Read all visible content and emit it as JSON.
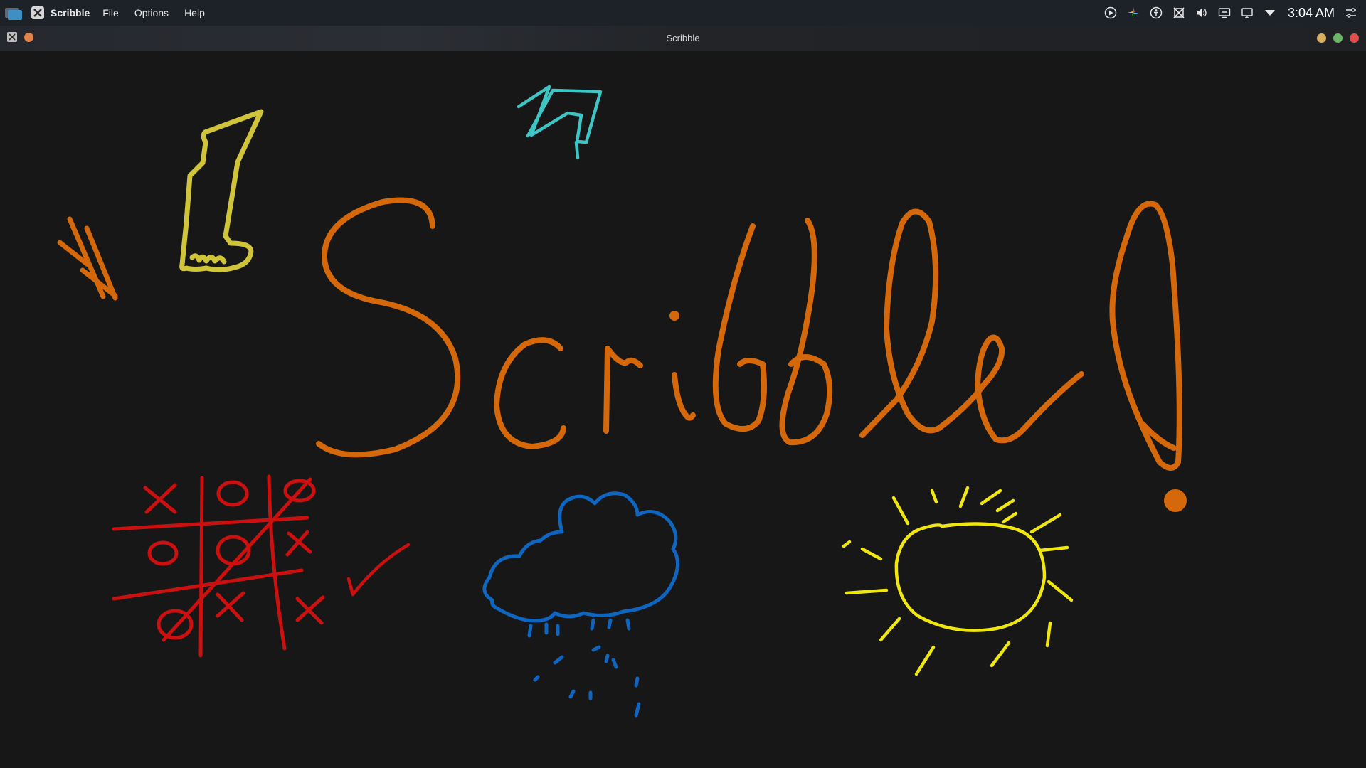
{
  "menubar": {
    "app_name": "Scribble",
    "menus": [
      "File",
      "Options",
      "Help"
    ],
    "clock": "3:04 AM"
  },
  "window": {
    "title": "Scribble"
  },
  "colors": {
    "orange": "#d4680a",
    "yellow_olive": "#cfc43a",
    "cyan": "#3ec5c5",
    "red": "#cc1010",
    "blue": "#0f66c0",
    "yellow": "#f0e610",
    "close": "#e0504a",
    "minimize": "#d8b060",
    "maximize": "#6cb866"
  },
  "canvas": {
    "headline": "Scribble!",
    "drawings": [
      "hash-sign",
      "raised-fist",
      "lightning-bolt",
      "tic-tac-toe",
      "check-mark",
      "rain-cloud",
      "sun"
    ]
  }
}
